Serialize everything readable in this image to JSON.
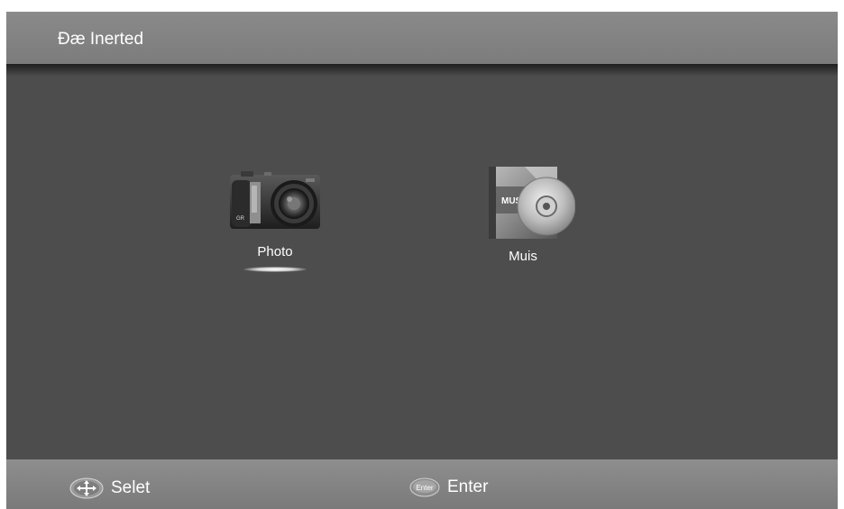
{
  "header": {
    "title": "Ðæ Inerted"
  },
  "menu": {
    "items": [
      {
        "label": "Photo",
        "icon": "camera-icon",
        "selected": true
      },
      {
        "label": "Muis",
        "icon": "music-disc-icon",
        "selected": false
      }
    ]
  },
  "footer": {
    "select_label": "Selet",
    "enter_label": "Enter",
    "enter_key_text": "Enter"
  },
  "colors": {
    "background": "#4d4d4d",
    "header": "#828282",
    "footer": "#838383",
    "text": "#ffffff"
  }
}
